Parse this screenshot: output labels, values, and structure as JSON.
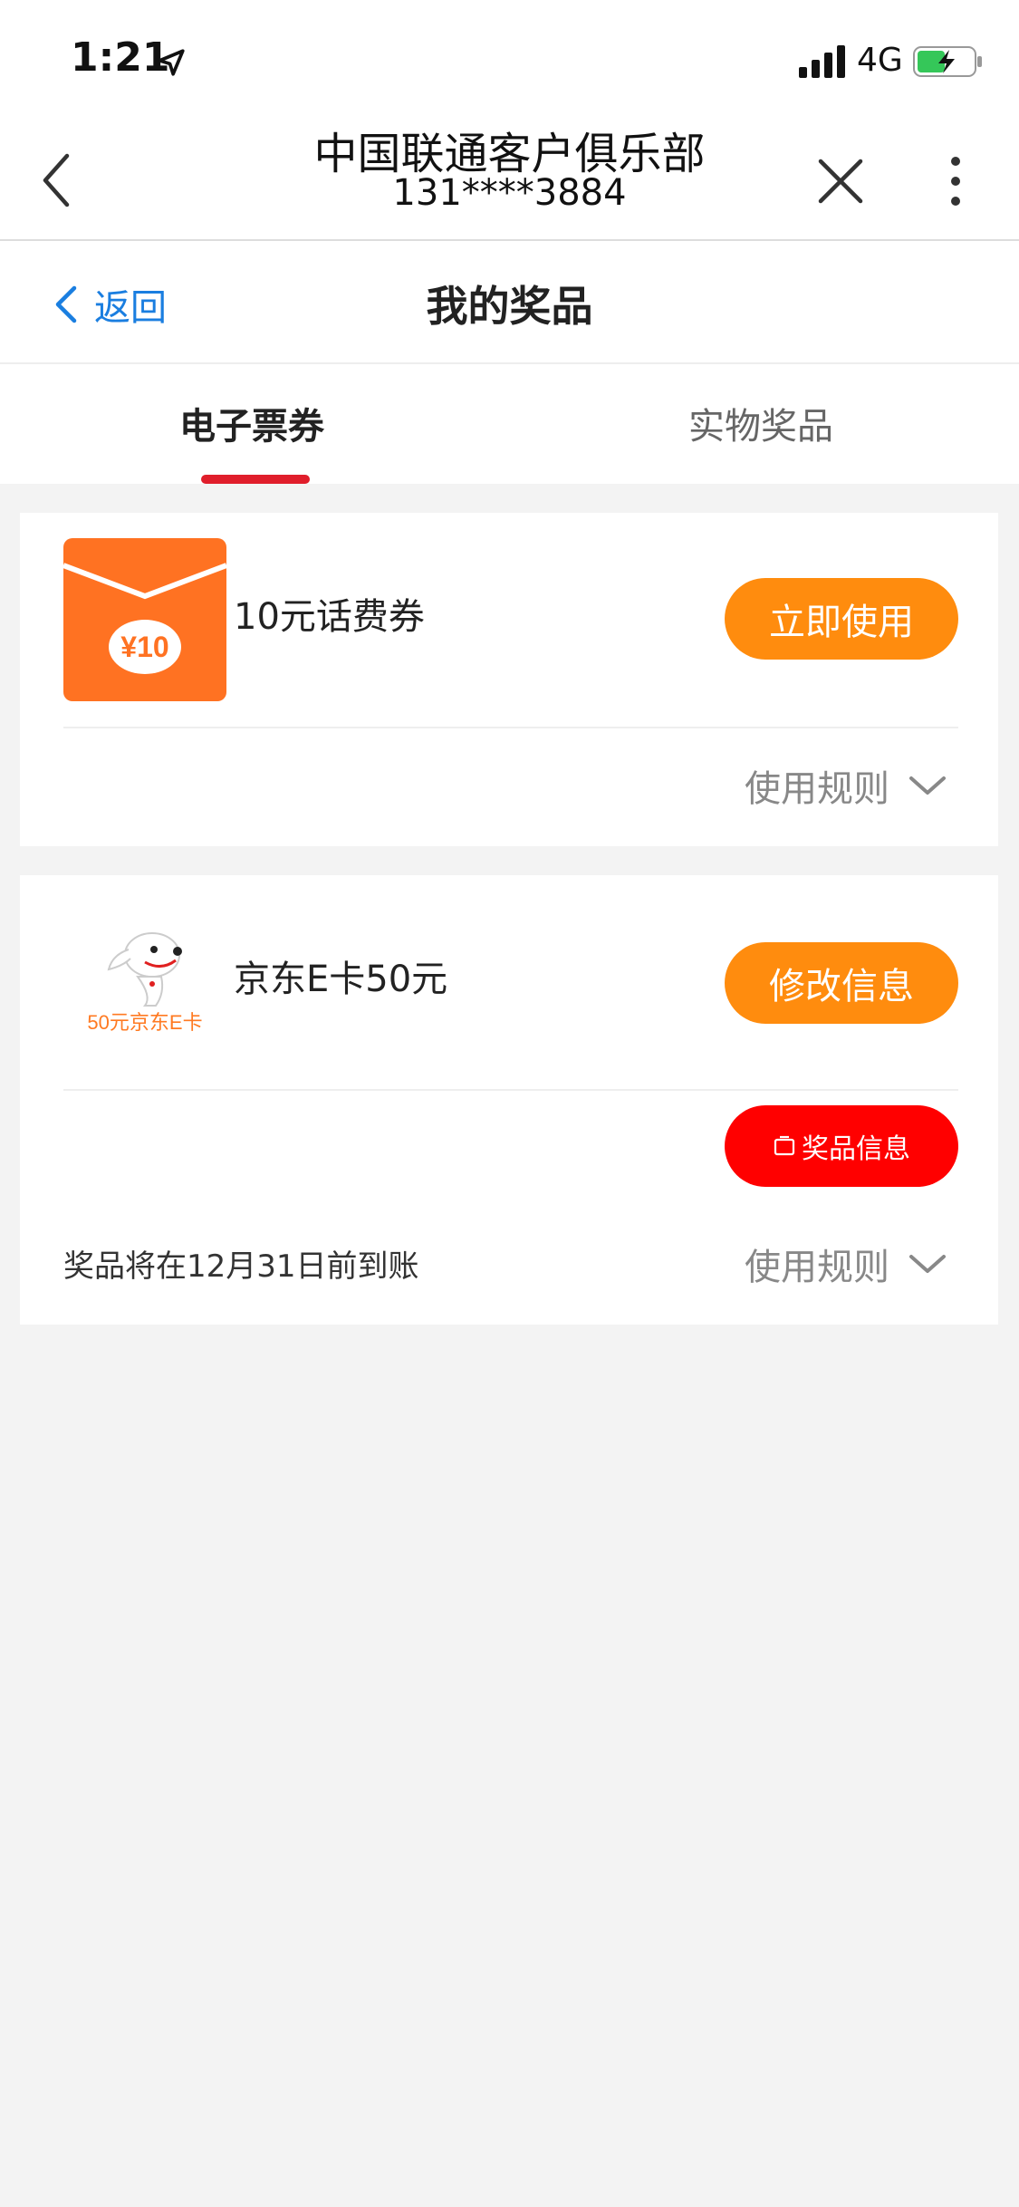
{
  "status_bar": {
    "time": "1:21",
    "network": "4G",
    "icons": [
      "location-arrow-icon",
      "signal-icon",
      "battery-charging-icon"
    ]
  },
  "header": {
    "title": "中国联通客户俱乐部",
    "subtitle": "131****3884",
    "icons": [
      "back-chevron-icon",
      "close-icon",
      "more-vertical-icon"
    ]
  },
  "subnav": {
    "back_label": "返回",
    "title": "我的奖品"
  },
  "tabs": [
    {
      "label": "电子票券",
      "active": true
    },
    {
      "label": "实物奖品",
      "active": false
    }
  ],
  "prizes": [
    {
      "name": "10元话费券",
      "icon": "red-packet-icon",
      "icon_text": "¥10",
      "action_label": "立即使用",
      "rules_label": "使用规则"
    },
    {
      "name": "京东E卡50元",
      "icon": "jd-mascot-icon",
      "icon_text": "50元京东E卡",
      "action_label": "修改信息",
      "info_label": "奖品信息",
      "note": "奖品将在12月31日前到账",
      "rules_label": "使用规则"
    }
  ],
  "colors": {
    "accent_orange": "#ff8c0e",
    "accent_red": "#ff0000",
    "tab_underline": "#e01e2b",
    "link_blue": "#1a7ee0",
    "background": "#f3f3f3"
  }
}
